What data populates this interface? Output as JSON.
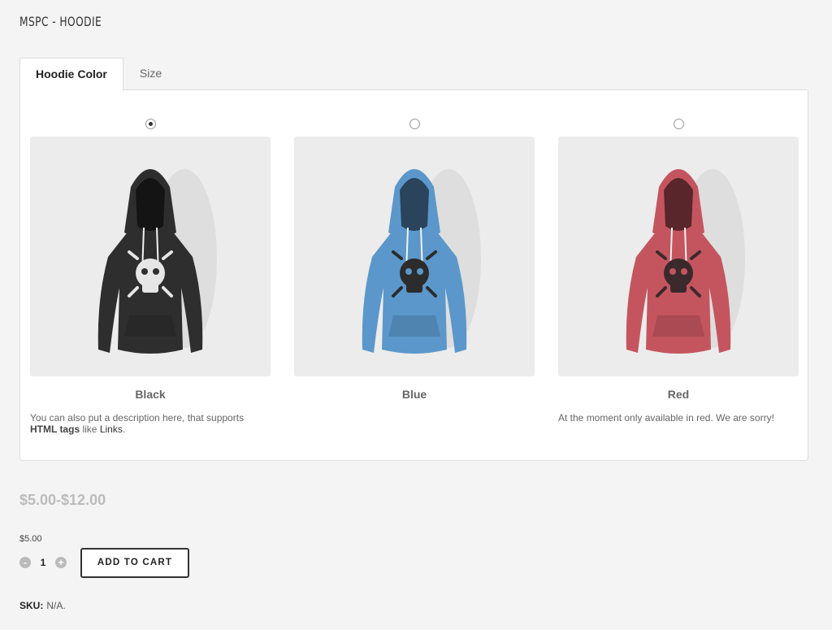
{
  "product": {
    "title": "MSPC - HOODIE"
  },
  "tabs": [
    {
      "label": "Hoodie Color",
      "active": true
    },
    {
      "label": "Size",
      "active": false
    }
  ],
  "options": [
    {
      "label": "Black",
      "selected": true,
      "color": "#2e2e2e",
      "print": "#e6e6e6",
      "description": {
        "before": "You can also put a description here, that supports ",
        "bold": "HTML tags",
        "middle": " like ",
        "link": "Links",
        "after": "."
      }
    },
    {
      "label": "Blue",
      "selected": false,
      "color": "#5b97ca",
      "print": "#2c2c2c"
    },
    {
      "label": "Red",
      "selected": false,
      "color": "#c4555f",
      "print": "#3a2a2c",
      "description": {
        "text": "At the moment only available in red. We are sorry!"
      }
    }
  ],
  "pricing": {
    "range": "$5.00-$12.00",
    "unit_price": "$5.00"
  },
  "quantity": {
    "minus": "-",
    "value": "1",
    "plus": "+"
  },
  "cart": {
    "button_label": "ADD TO CART"
  },
  "sku": {
    "label": "SKU:",
    "value": "N/A."
  },
  "colors": {
    "accent": "#333333",
    "muted_price": "#bbbbbb",
    "panel_border": "#dddddd"
  }
}
